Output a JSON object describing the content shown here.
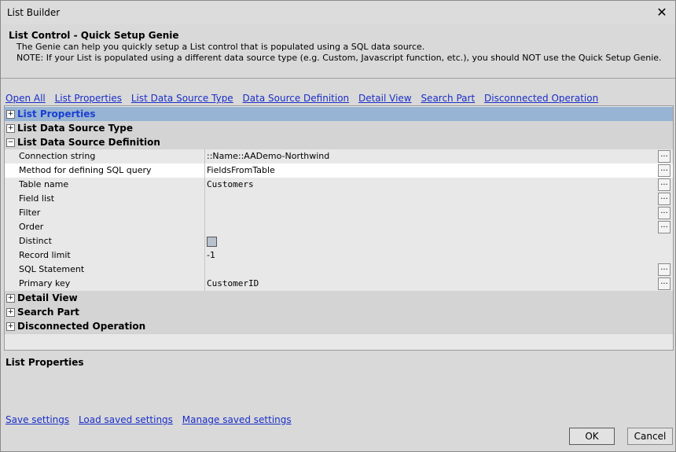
{
  "window": {
    "title": "List Builder",
    "close_glyph": "✕"
  },
  "header": {
    "title": "List Control - Quick Setup Genie",
    "line1": "The Genie can help you quickly setup a List control that is populated using a SQL data source.",
    "line2": "NOTE: If your List is populated using a different data source type (e.g. Custom, Javascript function, etc.), you should NOT use the Quick Setup Genie."
  },
  "nav": {
    "links": [
      "Open All",
      "List Properties",
      "List Data Source Type",
      "Data Source Definition",
      "Detail View",
      "Search Part",
      "Disconnected Operation"
    ]
  },
  "grid": {
    "sections": {
      "list_properties": "List Properties",
      "list_data_source_type": "List Data Source Type",
      "list_data_source_definition": "List Data Source Definition",
      "detail_view": "Detail View",
      "search_part": "Search Part",
      "disconnected_operation": "Disconnected Operation"
    },
    "props": [
      {
        "name": "Connection string",
        "value": "::Name::AADemo-Northwind"
      },
      {
        "name": "Method for defining SQL query",
        "value": "FieldsFromTable"
      },
      {
        "name": "Table name",
        "value": "Customers"
      },
      {
        "name": "Field list",
        "value": ""
      },
      {
        "name": "Filter",
        "value": ""
      },
      {
        "name": "Order",
        "value": ""
      },
      {
        "name": "Distinct",
        "value": ""
      },
      {
        "name": "Record limit",
        "value": "-1"
      },
      {
        "name": "SQL Statement",
        "value": ""
      },
      {
        "name": "Primary key",
        "value": "CustomerID"
      }
    ],
    "toggle_collapsed": "+",
    "toggle_expanded": "−",
    "ellipsis": "..."
  },
  "lower": {
    "title": "List Properties"
  },
  "bottom": {
    "links": [
      "Save settings",
      "Load saved settings",
      "Manage saved settings"
    ],
    "ok": "OK",
    "cancel": "Cancel"
  }
}
